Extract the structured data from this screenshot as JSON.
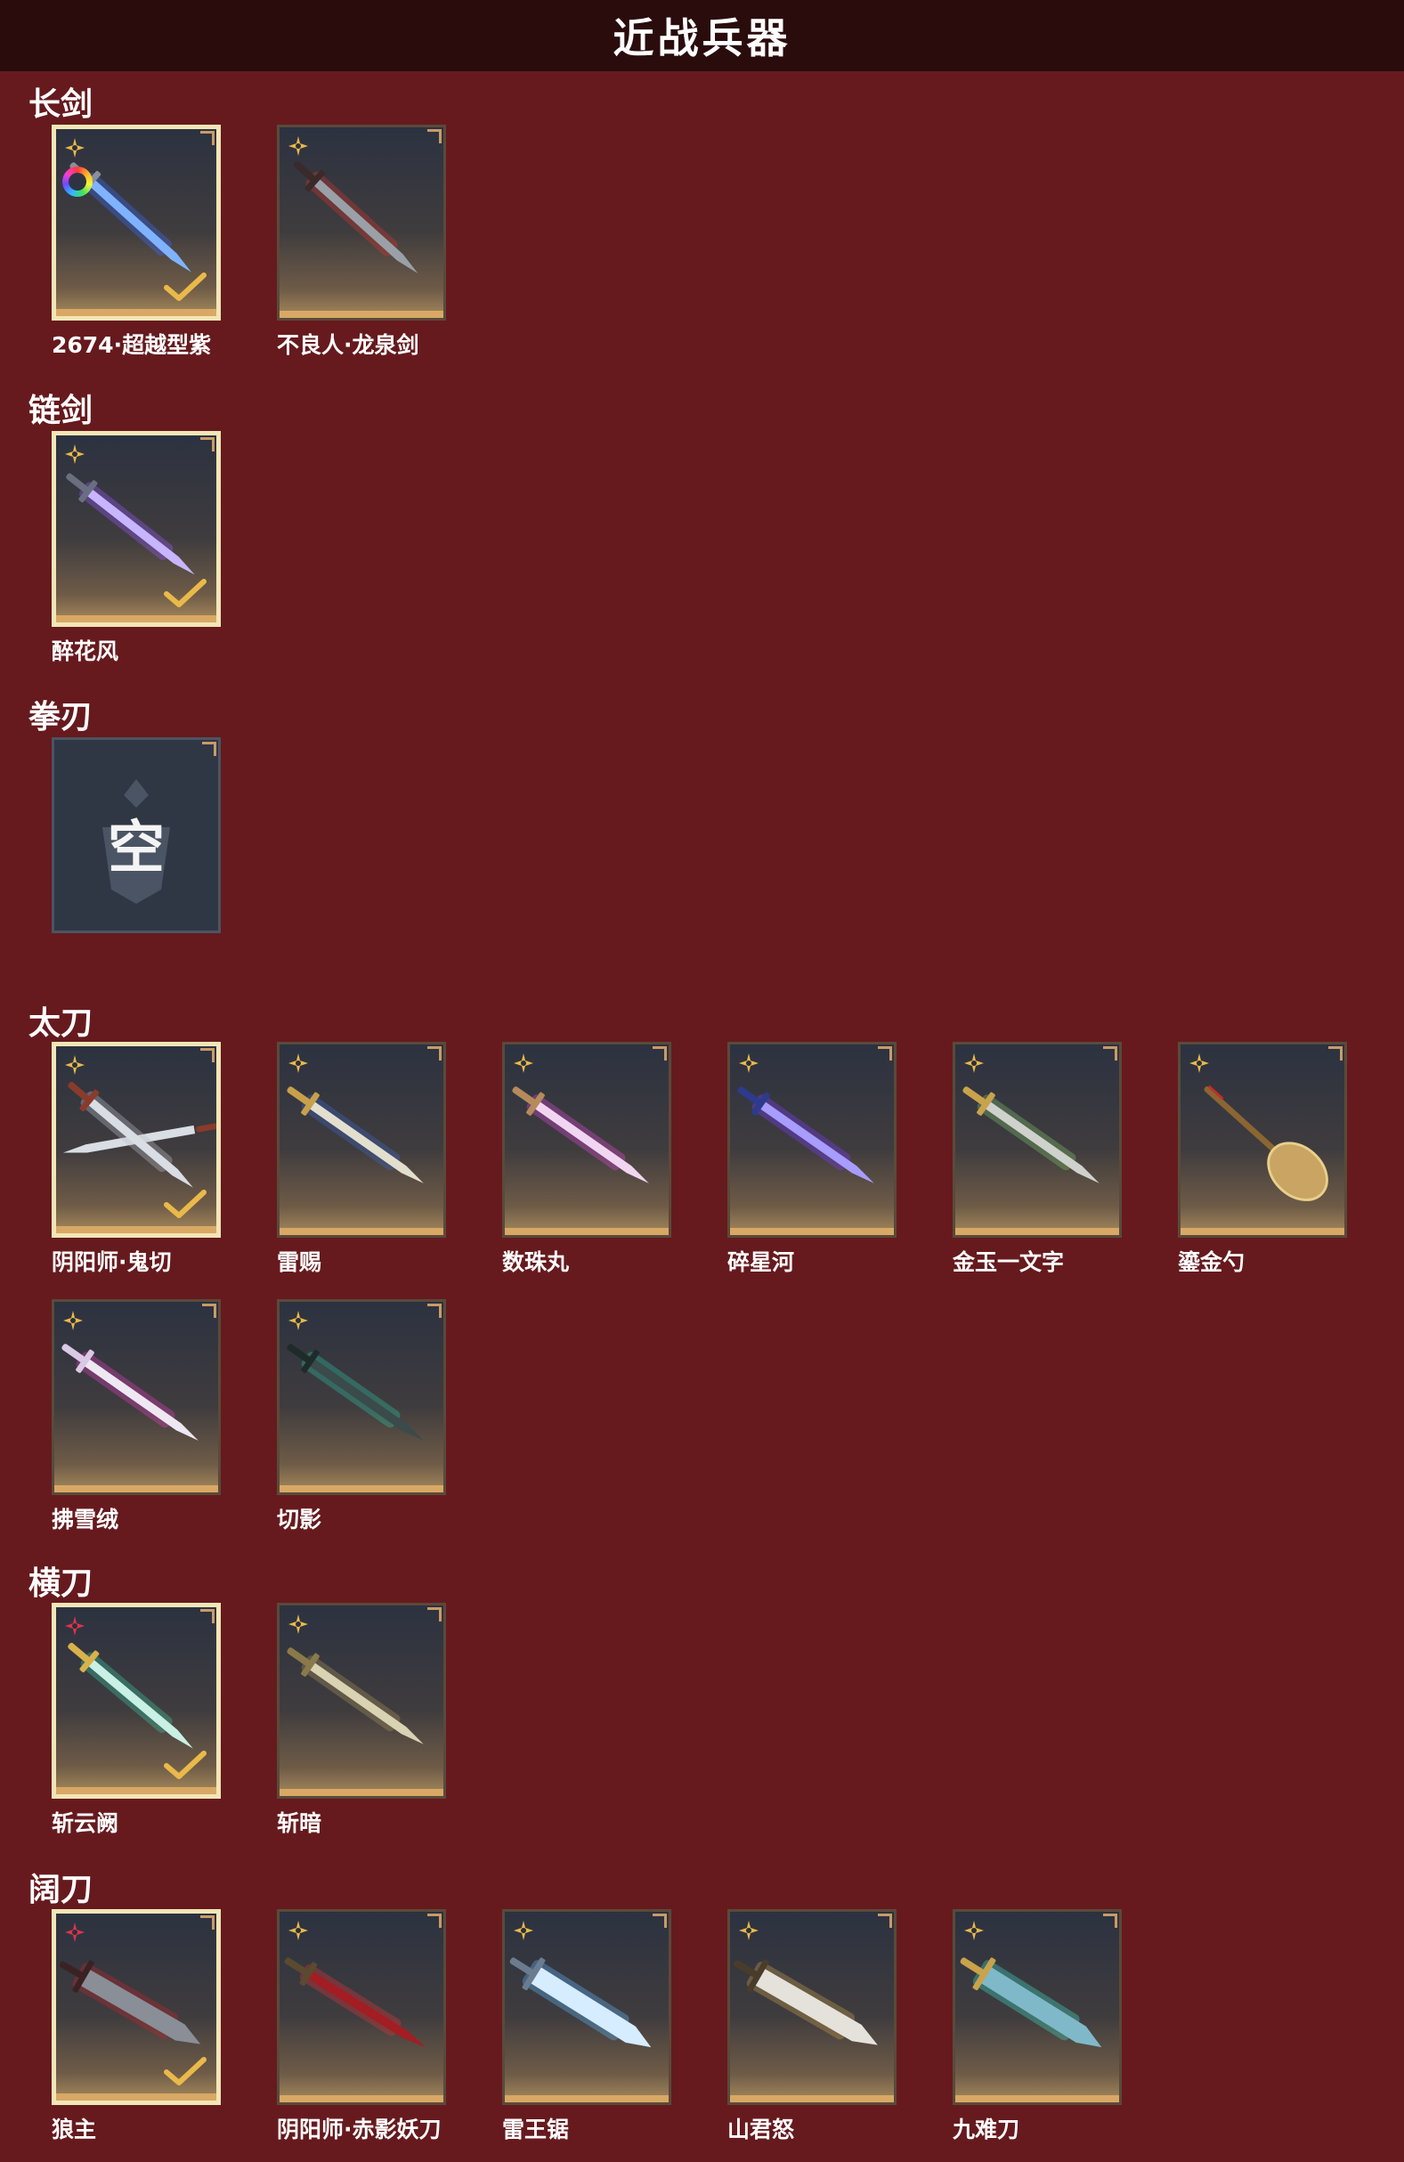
{
  "header": {
    "title": "近战兵器"
  },
  "colors": {
    "background": "#661a1e",
    "header_bg": "#2a0c0d",
    "card_bottom_bar": "#d9a865",
    "selected_border": "#f2e6b6",
    "grade_gold": "#e9b94a",
    "grade_red": "#e2334a"
  },
  "categories": [
    {
      "label": "长剑",
      "items": [
        {
          "name": "2674·超越型紫",
          "selected": true,
          "grade": "gold",
          "badge": "rainbow-ring",
          "art": "blue-energy-sword"
        },
        {
          "name": "不良人·龙泉剑",
          "selected": false,
          "grade": "gold",
          "art": "red-dragon-sword"
        }
      ]
    },
    {
      "label": "链剑",
      "items": [
        {
          "name": "醉花风",
          "selected": true,
          "grade": "gold",
          "art": "purple-chain-sword"
        }
      ]
    },
    {
      "label": "拳刃",
      "items": [
        {
          "name": "",
          "empty": true,
          "empty_label": "空"
        }
      ]
    },
    {
      "label": "太刀",
      "items": [
        {
          "name": "阴阳师·鬼切",
          "selected": true,
          "grade": "gold",
          "art": "crossed-katanas"
        },
        {
          "name": "雷赐",
          "selected": false,
          "grade": "gold",
          "art": "gold-blue-katana"
        },
        {
          "name": "数珠丸",
          "selected": false,
          "grade": "gold",
          "art": "pink-katana"
        },
        {
          "name": "碎星河",
          "selected": false,
          "grade": "gold",
          "art": "violet-katana"
        },
        {
          "name": "金玉一文字",
          "selected": false,
          "grade": "gold",
          "art": "jade-gold-katana"
        },
        {
          "name": "鎏金勺",
          "selected": false,
          "grade": "gold",
          "art": "golden-spoon"
        },
        {
          "name": "拂雪绒",
          "selected": false,
          "grade": "gold",
          "art": "white-pink-katana"
        },
        {
          "name": "切影",
          "selected": false,
          "grade": "gold",
          "art": "teal-katana"
        }
      ]
    },
    {
      "label": "横刀",
      "items": [
        {
          "name": "斩云阙",
          "selected": true,
          "grade": "red",
          "art": "jade-saber"
        },
        {
          "name": "斩暗",
          "selected": false,
          "grade": "gold",
          "art": "bronze-saber"
        }
      ]
    },
    {
      "label": "阔刀",
      "items": [
        {
          "name": "狼主",
          "selected": true,
          "grade": "red",
          "art": "red-broadblade"
        },
        {
          "name": "阴阳师·赤影妖刀",
          "selected": false,
          "grade": "gold",
          "art": "crimson-blade"
        },
        {
          "name": "雷王锯",
          "selected": false,
          "grade": "gold",
          "art": "ice-blade"
        },
        {
          "name": "山君怒",
          "selected": false,
          "grade": "gold",
          "art": "silver-gold-blade"
        },
        {
          "name": "九难刀",
          "selected": false,
          "grade": "gold",
          "art": "jade-dragon-blade"
        }
      ]
    }
  ]
}
